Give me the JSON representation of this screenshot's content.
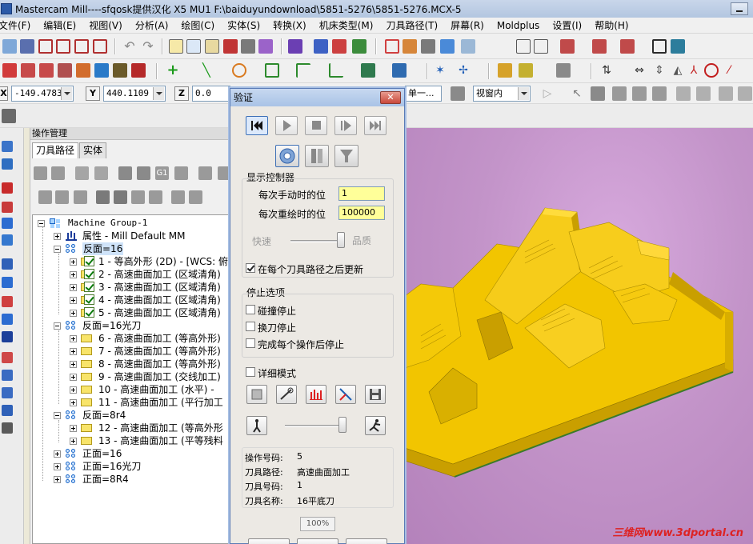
{
  "window": {
    "title": "Mastercam Mill----sfqosk提供汉化 X5 MU1  F:\\baiduyundownload\\5851-5276\\5851-5276.MCX-5"
  },
  "menu": [
    "文件(F)",
    "编辑(E)",
    "视图(V)",
    "分析(A)",
    "绘图(C)",
    "实体(S)",
    "转换(X)",
    "机床类型(M)",
    "刀具路径(T)",
    "屏幕(R)",
    "Moldplus",
    "设置(I)",
    "帮助(H)"
  ],
  "coords": {
    "x_label": "X",
    "x_value": "-149.4783",
    "y_label": "Y",
    "y_value": "440.1109",
    "z_label": "Z",
    "z_value": "0.0",
    "view_dropdown": "单一...",
    "viewport_dropdown": "视窗内"
  },
  "ops_manager": {
    "title": "操作管理",
    "tabs": [
      "刀具路径",
      "实体"
    ],
    "tree": [
      {
        "text": "Machine Group-1",
        "icon": "machine-group-icon"
      },
      {
        "text": "属性 - Mill Default MM",
        "icon": "properties-icon"
      },
      {
        "text": "反面=16",
        "icon": "toolpath-group-icon"
      },
      {
        "text": "1 - 等高外形 (2D) - [WCS: 俯",
        "icon": "checked-op"
      },
      {
        "text": "2 - 高速曲面加工 (区域清角)",
        "icon": "checked-op"
      },
      {
        "text": "3 - 高速曲面加工 (区域清角)",
        "icon": "checked-op"
      },
      {
        "text": "4 - 高速曲面加工 (区域清角)",
        "icon": "checked-op"
      },
      {
        "text": "5 - 高速曲面加工 (区域清角)",
        "icon": "checked-op"
      },
      {
        "text": "反面=16光刀",
        "icon": "toolpath-group-icon"
      },
      {
        "text": "6 - 高速曲面加工 (等高外形)",
        "icon": "folder-op"
      },
      {
        "text": "7 - 高速曲面加工 (等高外形)",
        "icon": "folder-op"
      },
      {
        "text": "8 - 高速曲面加工 (等高外形)",
        "icon": "folder-op"
      },
      {
        "text": "9 - 高速曲面加工 (交线加工)",
        "icon": "folder-op"
      },
      {
        "text": "10 - 高速曲面加工 (水平) -",
        "icon": "folder-op"
      },
      {
        "text": "11 - 高速曲面加工 (平行加工",
        "icon": "folder-op"
      },
      {
        "text": "反面=8r4",
        "icon": "toolpath-group-icon"
      },
      {
        "text": "12 - 高速曲面加工 (等高外形",
        "icon": "folder-op"
      },
      {
        "text": "13 - 高速曲面加工 (平等残料",
        "icon": "folder-op"
      },
      {
        "text": "正面=16",
        "icon": "toolpath-group-icon"
      },
      {
        "text": "正面=16光刀",
        "icon": "toolpath-group-icon"
      },
      {
        "text": "正面=8R4",
        "icon": "toolpath-group-icon"
      }
    ]
  },
  "verify": {
    "title": "验证",
    "display_control": "显示控制器",
    "step_label": "每次手动时的位",
    "step_value": "1",
    "redraw_label": "每次重绘时的位",
    "redraw_value": "100000",
    "speed_label": "快速",
    "quality_label": "品质",
    "update_after_each": "在每个刀具路径之后更新",
    "stop_options": "停止选项",
    "stop_collision": "碰撞停止",
    "stop_tool_change": "换刀停止",
    "stop_each_op": "完成每个操作后停止",
    "verbose_mode": "详细模式",
    "info": {
      "op_number_label": "操作号码:",
      "op_number": "5",
      "toolpath_label": "刀具路径:",
      "toolpath": "高速曲面加工",
      "tool_number_label": "刀具号码:",
      "tool_number": "1",
      "tool_name_label": "刀具名称:",
      "tool_name": "16平底刀"
    },
    "progress": "100%"
  },
  "watermark": "三维网www.3dportal.cn",
  "colors": {
    "part": "#f2c500",
    "viewport_bg": "#c79bcc"
  }
}
